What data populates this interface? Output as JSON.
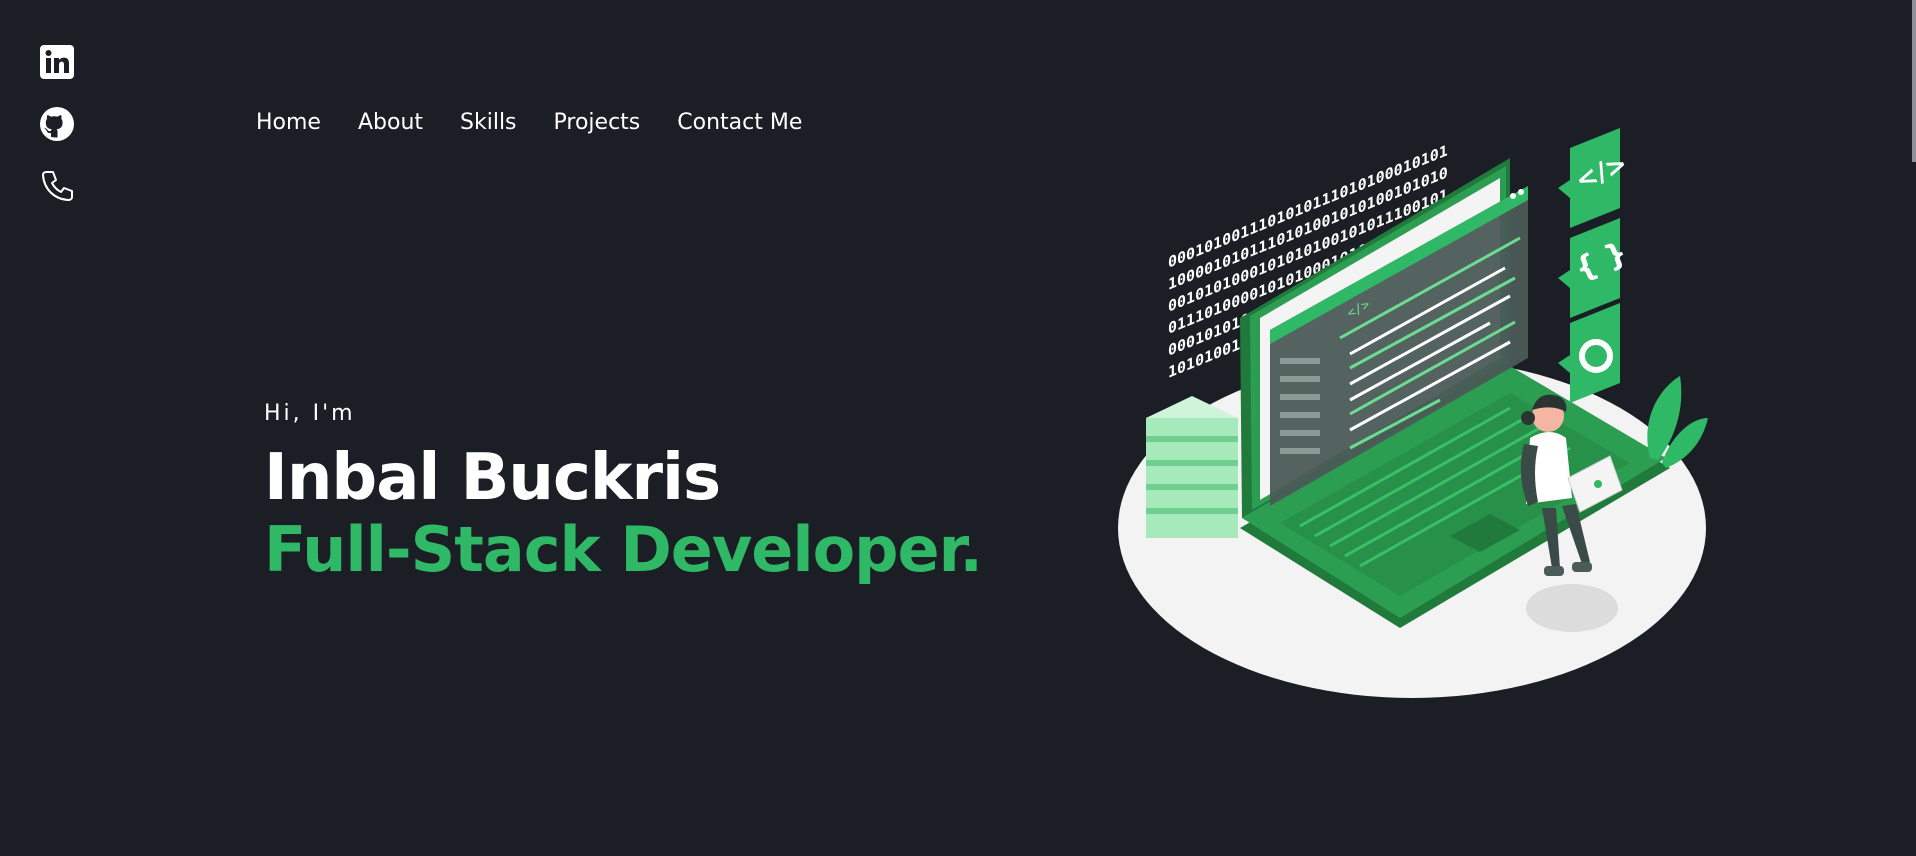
{
  "social": [
    {
      "name": "linkedin-icon",
      "label": "LinkedIn"
    },
    {
      "name": "github-icon",
      "label": "GitHub"
    },
    {
      "name": "phone-icon",
      "label": "Phone"
    }
  ],
  "nav": {
    "items": [
      {
        "label": "Home"
      },
      {
        "label": "About"
      },
      {
        "label": "Skills"
      },
      {
        "label": "Projects"
      },
      {
        "label": "Contact Me"
      }
    ]
  },
  "hero": {
    "greeting": "Hi, I'm",
    "name": "Inbal Buckris",
    "role": "Full-Stack Developer."
  },
  "illustration": {
    "binary_lines": [
      "0001010011101010111010100010101",
      "1000010101110101001010100101010",
      "0010101000101010100101011100101",
      "0111010000101010001010101001010",
      "0001010100101010100101010100101",
      "1010100101010010101001010010101"
    ],
    "code_tag": "</>"
  },
  "colors": {
    "background": "#1b1e24",
    "accent": "#2fb866",
    "text": "#ffffff"
  }
}
